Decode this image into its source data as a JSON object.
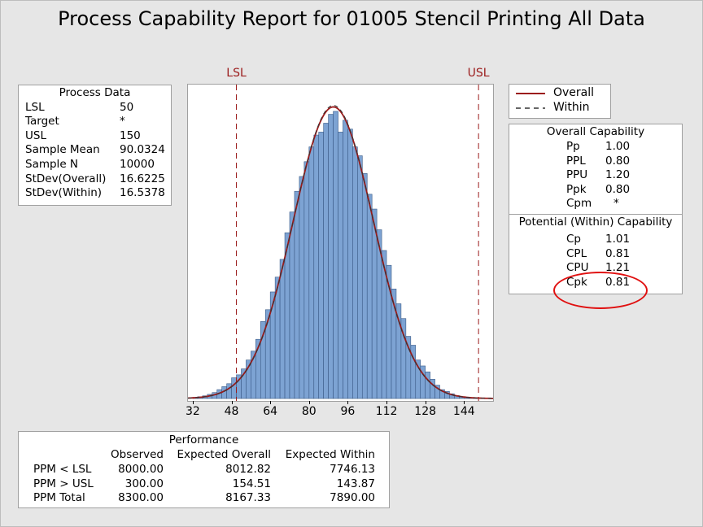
{
  "title": "Process Capability Report for 01005 Stencil Printing All Data",
  "process_data": {
    "heading": "Process Data",
    "rows": [
      {
        "label": "LSL",
        "value": "50"
      },
      {
        "label": "Target",
        "value": "*"
      },
      {
        "label": "USL",
        "value": "150"
      },
      {
        "label": "Sample Mean",
        "value": "90.0324"
      },
      {
        "label": "Sample N",
        "value": "10000"
      },
      {
        "label": "StDev(Overall)",
        "value": "16.6225"
      },
      {
        "label": "StDev(Within)",
        "value": "16.5378"
      }
    ]
  },
  "legend": {
    "overall": "Overall",
    "within": "Within",
    "overall_color": "#9b1b1b",
    "within_color": "#333333"
  },
  "overall_capability": {
    "heading": "Overall Capability",
    "rows": [
      {
        "label": "Pp",
        "value": "1.00"
      },
      {
        "label": "PPL",
        "value": "0.80"
      },
      {
        "label": "PPU",
        "value": "1.20"
      },
      {
        "label": "Ppk",
        "value": "0.80"
      },
      {
        "label": "Cpm",
        "value": "*"
      }
    ]
  },
  "within_capability": {
    "heading": "Potential (Within) Capability",
    "rows": [
      {
        "label": "Cp",
        "value": "1.01"
      },
      {
        "label": "CPL",
        "value": "0.81"
      },
      {
        "label": "CPU",
        "value": "1.21"
      },
      {
        "label": "Cpk",
        "value": "0.81"
      }
    ]
  },
  "performance": {
    "heading": "Performance",
    "columns": [
      "Observed",
      "Expected Overall",
      "Expected Within"
    ],
    "rows": [
      {
        "label": "PPM < LSL",
        "values": [
          "8000.00",
          "8012.82",
          "7746.13"
        ]
      },
      {
        "label": "PPM > USL",
        "values": [
          "300.00",
          "154.51",
          "143.87"
        ]
      },
      {
        "label": "PPM Total",
        "values": [
          "8300.00",
          "8167.33",
          "7890.00"
        ]
      }
    ]
  },
  "chart_data": {
    "type": "bar",
    "subtype": "histogram",
    "bin_width": 2,
    "bin_start": 32,
    "xlim": [
      30,
      156
    ],
    "ylim": [
      0,
      1
    ],
    "x_ticks": [
      32,
      48,
      64,
      80,
      96,
      112,
      128,
      144
    ],
    "grid": false,
    "bar_color": "#7da3d3",
    "lsl": {
      "label": "LSL",
      "value": 50
    },
    "usl": {
      "label": "USL",
      "value": 150
    },
    "spec_color": "#9b1b1b",
    "bins_relative_height": [
      0.004,
      0.006,
      0.009,
      0.014,
      0.02,
      0.03,
      0.04,
      0.05,
      0.07,
      0.08,
      0.1,
      0.13,
      0.16,
      0.2,
      0.26,
      0.3,
      0.36,
      0.41,
      0.47,
      0.56,
      0.63,
      0.7,
      0.75,
      0.8,
      0.85,
      0.89,
      0.9,
      0.93,
      0.96,
      0.97,
      0.9,
      0.94,
      0.91,
      0.85,
      0.82,
      0.76,
      0.69,
      0.64,
      0.57,
      0.5,
      0.45,
      0.37,
      0.32,
      0.27,
      0.21,
      0.18,
      0.13,
      0.11,
      0.09,
      0.065,
      0.045,
      0.03,
      0.024,
      0.016,
      0.01,
      0.006,
      0.004,
      0.002,
      0.001,
      0.001
    ],
    "curves": [
      {
        "name": "Overall",
        "mean": 90.0324,
        "stdev": 16.6225
      },
      {
        "name": "Within",
        "mean": 90.0324,
        "stdev": 16.5378
      }
    ]
  }
}
